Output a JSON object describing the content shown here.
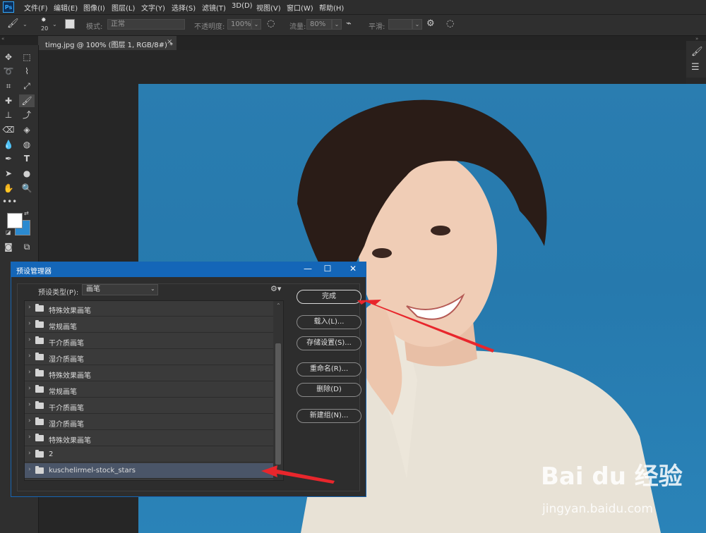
{
  "app": {
    "logo": "Ps",
    "menu": [
      "文件(F)",
      "编辑(E)",
      "图像(I)",
      "图层(L)",
      "文字(Y)",
      "选择(S)",
      "滤镜(T)",
      "3D(D)",
      "视图(V)",
      "窗口(W)",
      "帮助(H)"
    ]
  },
  "options_bar": {
    "brush_size": "20",
    "mode_label": "模式:",
    "mode_value": "正常",
    "opacity_label": "不透明度:",
    "opacity_value": "100%",
    "flow_label": "流量:",
    "flow_value": "80%",
    "smooth_label": "平滑:",
    "smooth_value": ""
  },
  "document_tab": {
    "title": "timg.jpg @ 100% (图层 1, RGB/8#) *",
    "close": "×"
  },
  "colors": {
    "foreground": "#ffffff",
    "background": "#2b8ad0",
    "dialog_title_bg": "#1466b8",
    "arrow": "#e8262c",
    "photo_bg": "#2a7db0"
  },
  "dialog": {
    "title": "预设管理器",
    "controls": {
      "minimize": "—",
      "maximize": "☐",
      "close": "✕"
    },
    "preset_type_label": "预设类型(P):",
    "preset_type_value": "画笔",
    "list": [
      "特殊效果画笔",
      "常规画笔",
      "干介质画笔",
      "湿介质画笔",
      "特殊效果画笔",
      "常规画笔",
      "干介质画笔",
      "湿介质画笔",
      "特殊效果画笔",
      "2",
      "kuschelirmel-stock_stars"
    ],
    "selected_index": 10,
    "buttons": {
      "done": "完成",
      "load": "载入(L)...",
      "save": "存储设置(S)...",
      "rename": "重命名(R)...",
      "delete": "删除(D)",
      "new_group": "新建组(N)..."
    }
  },
  "watermark": {
    "logo": "Bai du 经验",
    "url": "jingyan.baidu.com"
  }
}
